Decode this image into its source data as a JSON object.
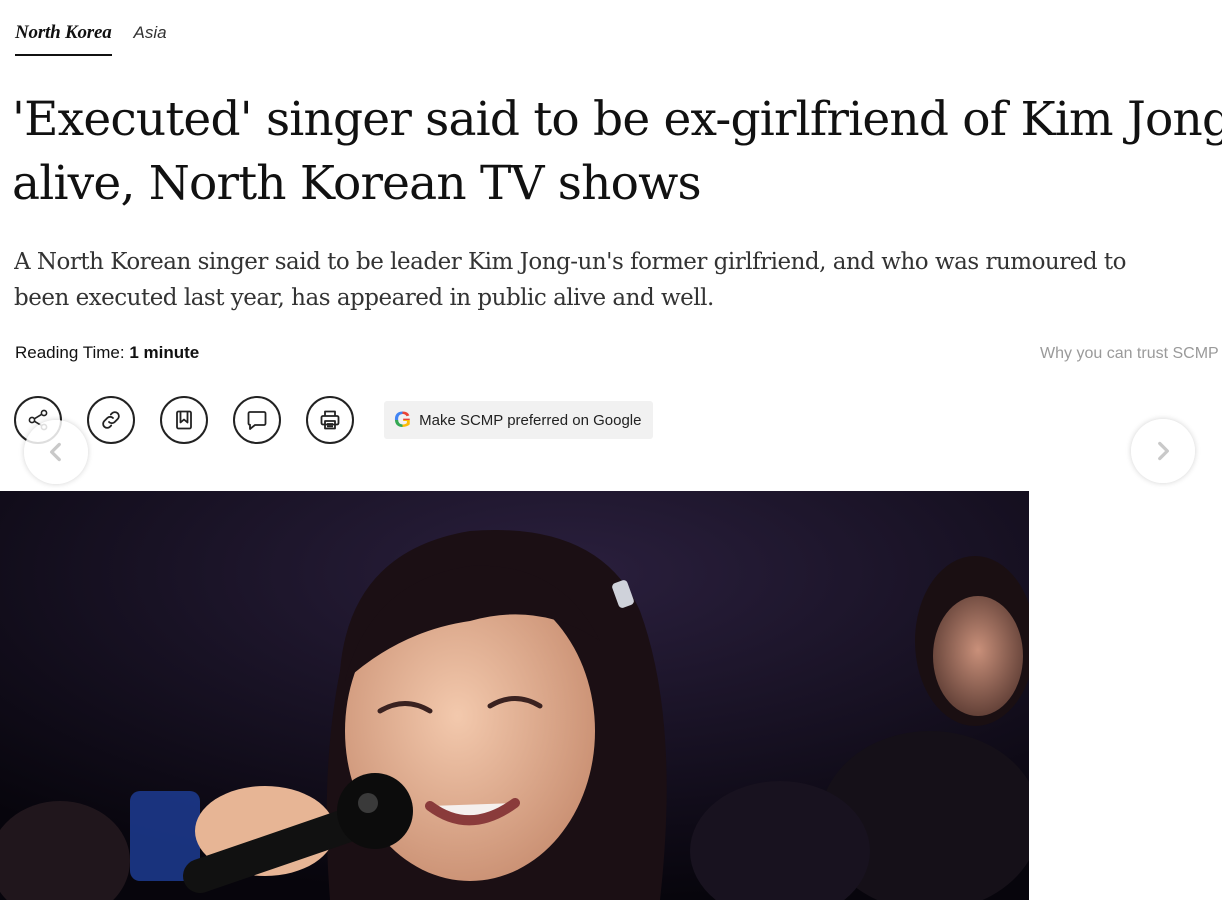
{
  "section": {
    "primary_tag": "North Korea",
    "secondary_tag": "Asia"
  },
  "article": {
    "headline_line1": "'Executed' singer said to be ex-girlfriend of Kim Jong-un",
    "headline_line2": "alive, North Korean TV shows",
    "summary_line1": "A North Korean singer said to be leader Kim Jong-un's former girlfriend, and who was rumoured to",
    "summary_line2": "been executed last year, has appeared in public alive and well.",
    "reading_time_label": "Reading Time: ",
    "reading_time_value": "1 minute",
    "trust_link": "Why you can trust SCMP"
  },
  "actions": {
    "share_icon": "share-icon",
    "link_icon": "link-icon",
    "bookmark_icon": "bookmark-icon",
    "comment_icon": "comment-icon",
    "print_icon": "print-icon",
    "google_logo_letter": "G",
    "google_pref_label": "Make SCMP preferred on Google"
  },
  "carousel": {
    "prev_icon": "chevron-left-icon",
    "next_icon": "chevron-right-icon"
  },
  "colors": {
    "text": "#111111",
    "muted": "#9a9a9a",
    "pill_bg": "#f1f1f1",
    "photo_bg": "#0d0a14"
  }
}
